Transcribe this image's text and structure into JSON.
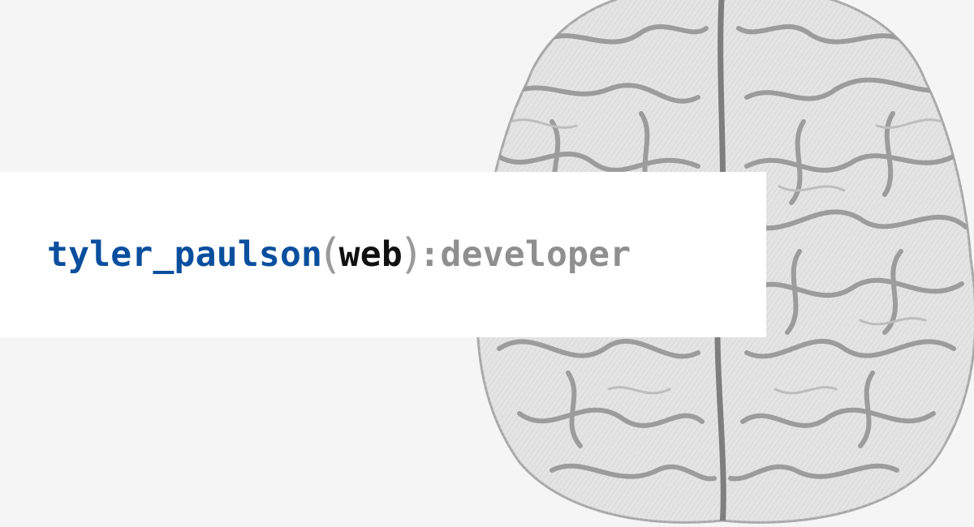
{
  "header": {
    "name": "tyler_paulson",
    "open_paren": "(",
    "qualifier": "web",
    "close_paren": ")",
    "separator": ":",
    "role": "developer"
  },
  "colors": {
    "background": "#f5f5f5",
    "card": "#ffffff",
    "name": "#0a4f9e",
    "paren": "#9a9a9a",
    "qualifier": "#111111",
    "role": "#8f8f8f",
    "illustration": "#a8a8a8"
  },
  "illustration": {
    "icon": "brain-illustration-icon"
  }
}
